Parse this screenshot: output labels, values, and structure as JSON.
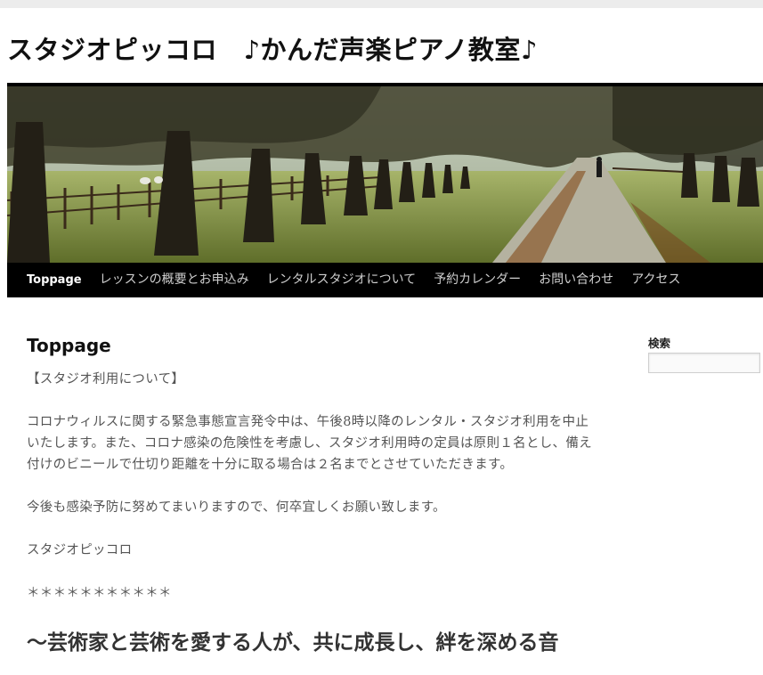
{
  "site": {
    "title": "スタジオピッコロ　♪かんだ声楽ピアノ教室♪"
  },
  "nav": {
    "items": [
      {
        "label": "Toppage",
        "active": true
      },
      {
        "label": "レッスンの概要とお申込み"
      },
      {
        "label": "レンタルスタジオについて"
      },
      {
        "label": "予約カレンダー"
      },
      {
        "label": "お問い合わせ"
      },
      {
        "label": "アクセス"
      }
    ]
  },
  "main": {
    "title": "Toppage",
    "paragraphs": [
      "【スタジオ利用について】",
      "コロナウィルスに関する緊急事態宣言発令中は、午後8時以降のレンタル・スタジオ利用を中止いたします。また、コロナ感染の危険性を考慮し、スタジオ利用時の定員は原則１名とし、備え付けのビニールで仕切り距離を十分に取る場合は２名までとさせていただきます。",
      "今後も感染予防に努めてまいりますので、何卒宜しくお願い致します。",
      "スタジオピッコロ",
      "＊＊＊＊＊＊＊＊＊＊＊"
    ],
    "heading": "～芸術家と芸術を愛する人が、共に成長し、絆を深める音"
  },
  "sidebar": {
    "search_title": "検索",
    "search_value": ""
  },
  "colors": {
    "nav_bg": "#000000",
    "nav_text": "#cfcfcf",
    "body_text": "#555555"
  }
}
